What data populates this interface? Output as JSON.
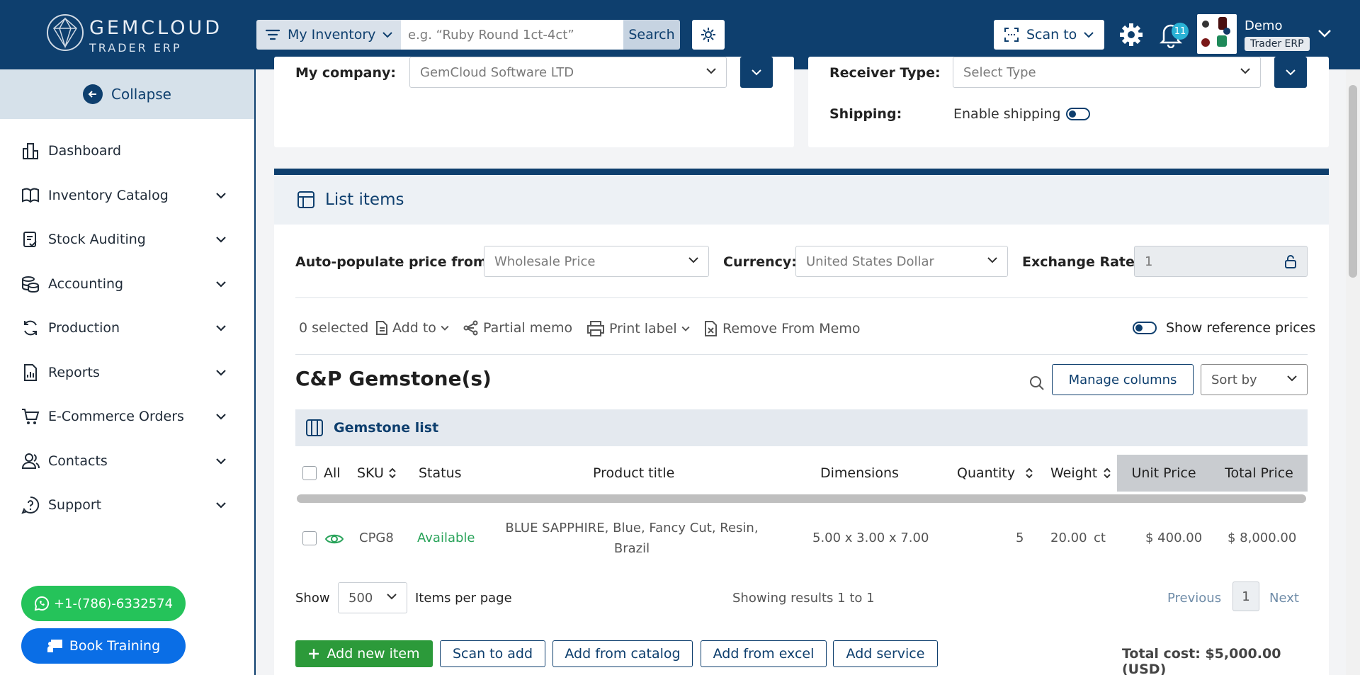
{
  "brand": {
    "name": "GEMCLOUD",
    "sub": "TRADER ERP"
  },
  "search": {
    "scope_label": "My Inventory",
    "placeholder": "e.g. “Ruby Round 1ct-4ct”",
    "button": "Search"
  },
  "header": {
    "scan_label": "Scan to",
    "notification_count": "11",
    "user_name": "Demo",
    "user_role": "Trader ERP"
  },
  "sidebar": {
    "collapse_label": "Collapse",
    "items": [
      {
        "label": "Dashboard",
        "icon": "dashboard-icon",
        "has_children": false
      },
      {
        "label": "Inventory Catalog",
        "icon": "book-icon",
        "has_children": true
      },
      {
        "label": "Stock Auditing",
        "icon": "clipboard-check-icon",
        "has_children": true
      },
      {
        "label": "Accounting",
        "icon": "coins-icon",
        "has_children": true
      },
      {
        "label": "Production",
        "icon": "refresh-icon",
        "has_children": true
      },
      {
        "label": "Reports",
        "icon": "report-icon",
        "has_children": true
      },
      {
        "label": "E-Commerce Orders",
        "icon": "cart-icon",
        "has_children": true
      },
      {
        "label": "Contacts",
        "icon": "contacts-icon",
        "has_children": true
      },
      {
        "label": "Support",
        "icon": "help-icon",
        "has_children": true
      }
    ],
    "whatsapp": "+1-(786)-6332574",
    "training": "Book Training"
  },
  "form": {
    "company_label": "My company:",
    "company_value": "GemCloud Software LTD",
    "receiver_label": "Receiver Type:",
    "receiver_placeholder": "Select Type",
    "shipping_label": "Shipping:",
    "shipping_toggle_label": "Enable shipping"
  },
  "list": {
    "title": "List items",
    "autopop_label": "Auto-populate price from:",
    "autopop_value": "Wholesale Price",
    "currency_label": "Currency:",
    "currency_value": "United States Dollar",
    "rate_label": "Exchange Rate:",
    "rate_value": "1",
    "selected": "0 selected",
    "add_to": "Add to",
    "partial_memo": "Partial memo",
    "print_label": "Print label",
    "remove_memo": "Remove From Memo",
    "ref_prices": "Show reference prices",
    "section_title": "C&P Gemstone(s)",
    "manage_columns": "Manage columns",
    "sort_by": "Sort by",
    "gem_list": "Gemstone list",
    "columns": {
      "all": "All",
      "sku": "SKU",
      "status": "Status",
      "title": "Product title",
      "dims": "Dimensions",
      "qty": "Quantity",
      "weight": "Weight",
      "unit_price": "Unit Price",
      "total_price": "Total Price"
    },
    "rows": [
      {
        "sku": "CPG8",
        "status": "Available",
        "title_line1": "BLUE SAPPHIRE, Blue, Fancy Cut, Resin,",
        "title_line2": "Brazil",
        "dims": "5.00 x 3.00 x 7.00",
        "qty": "5",
        "weight": "20.00",
        "weight_unit": "ct",
        "unit_price": "$ 400.00",
        "total_price": "$ 8,000.00"
      }
    ],
    "show_label": "Show",
    "per_page": "500",
    "per_page_label": "Items per page",
    "results": "Showing results 1 to 1",
    "prev": "Previous",
    "page": "1",
    "next": "Next",
    "add_new": "Add new item",
    "scan_add": "Scan to add",
    "add_catalog": "Add from catalog",
    "add_excel": "Add from excel",
    "add_service": "Add service",
    "total_cost": "Total cost: $5,000.00 (USD)"
  },
  "colors": {
    "brand": "#0e3f6e",
    "success": "#29a35a",
    "whatsapp": "#25c35a",
    "training": "#0a6ee6"
  }
}
